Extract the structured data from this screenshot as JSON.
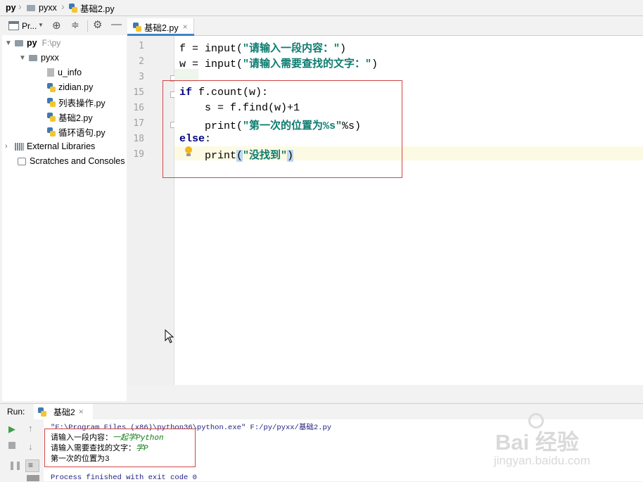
{
  "breadcrumb": {
    "root": "py",
    "folder": "pyxx",
    "file": "基础2.py"
  },
  "project_panel": {
    "view_label": "Pr...",
    "root": {
      "name": "py",
      "path": "F:\\py"
    },
    "folder": "pyxx",
    "files": [
      "u_info",
      "zidian.py",
      "列表操作.py",
      "基础2.py",
      "循环语句.py"
    ],
    "external_libraries": "External Libraries",
    "scratches": "Scratches and Consoles"
  },
  "editor": {
    "tab_label": "基础2.py",
    "tab_close": "×",
    "lines": [
      {
        "num": "1",
        "parts": [
          [
            "plain",
            "f = input("
          ],
          [
            "str",
            "\"请输入一段内容：\""
          ],
          [
            "plain",
            ")"
          ]
        ]
      },
      {
        "num": "2",
        "parts": [
          [
            "plain",
            "w = input("
          ],
          [
            "str",
            "\"请输入需要查找的文字：\""
          ],
          [
            "plain",
            ")"
          ]
        ]
      },
      {
        "num": "3",
        "parts": []
      },
      {
        "num": "15",
        "parts": [
          [
            "kw",
            "if"
          ],
          [
            "plain",
            " f.count(w):"
          ]
        ]
      },
      {
        "num": "16",
        "parts": [
          [
            "plain",
            "    s = f.find(w)+1"
          ]
        ]
      },
      {
        "num": "17",
        "parts": [
          [
            "plain",
            "    print("
          ],
          [
            "str",
            "\"第一次的位置为%s\""
          ],
          [
            "plain",
            "%s)"
          ]
        ]
      },
      {
        "num": "18",
        "parts": [
          [
            "kw",
            "else"
          ],
          [
            "plain",
            ":"
          ]
        ]
      },
      {
        "num": "19",
        "parts": [
          [
            "plain",
            "    print"
          ],
          [
            "hl",
            "("
          ],
          [
            "str",
            "\"没找到\""
          ],
          [
            "hl",
            ")"
          ]
        ]
      }
    ]
  },
  "run": {
    "label": "Run:",
    "config_name": "基础2",
    "close": "×",
    "console": {
      "command": "\"F:\\Program Files (x86)\\python36\\python.exe\" F:/py/pyxx/基础2.py",
      "prompt1": "请输入一段内容：",
      "input1": "一起学Python",
      "prompt2": "请输入需要查找的文字：",
      "input2": "学P",
      "result": "第一次的位置为3",
      "exit": "Process finished with exit code 0"
    }
  },
  "watermark": {
    "brand": "Bai  经验",
    "url": "jingyan.baidu.com"
  }
}
